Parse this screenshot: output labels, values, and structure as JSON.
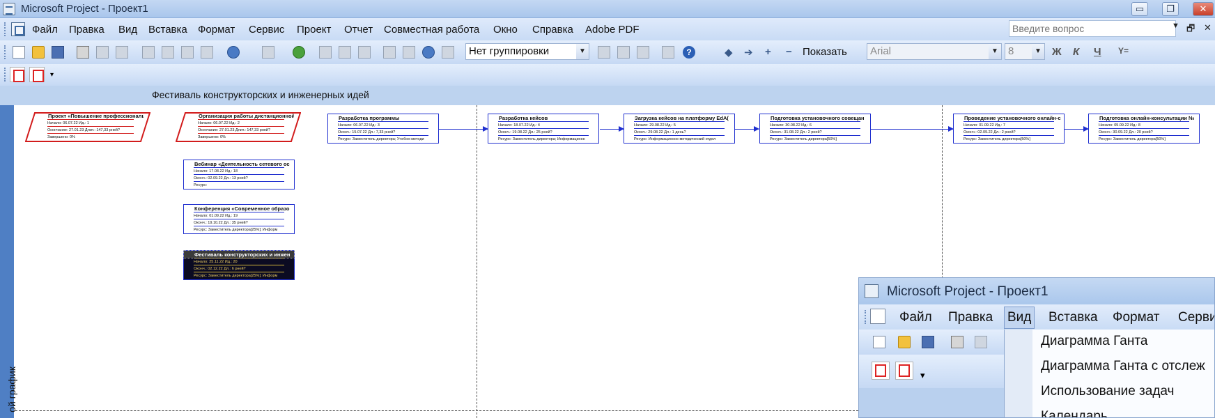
{
  "window": {
    "title": "Microsoft Project - Проект1",
    "buttons": {
      "minimize": "▭",
      "restore": "❐",
      "close": "✕"
    }
  },
  "menu": {
    "items": [
      "Файл",
      "Правка",
      "Вид",
      "Вставка",
      "Формат",
      "Сервис",
      "Проект",
      "Отчет",
      "Совместная работа",
      "Окно",
      "Справка",
      "Adobe PDF"
    ],
    "ask_placeholder": "Введите вопрос",
    "mdi_controls": [
      "▾",
      "🗗",
      "✕"
    ]
  },
  "toolbar": {
    "grouping": "Нет группировки",
    "show_label": "Показать",
    "font": "Arial",
    "font_size": "8",
    "format_buttons": [
      "Ж",
      "К",
      "Ч"
    ],
    "filter_symbol": "Y="
  },
  "project_title": "Фестиваль конструкторских и инженерных идей",
  "side_tab": "ой график",
  "nodes": [
    {
      "title": "Проект «Повышение профессионалы",
      "r1": "Начало:   06.07.22      Ид.:    1",
      "r2": "Окончание: 27.01.23   Длит.: 147,33 рней?",
      "r3": "Завершено: 0%",
      "kind": "crit"
    },
    {
      "title": "Организация работы дистанционной ст",
      "r1": "Начало:   06.07.22      Ид.:    2",
      "r2": "Окончание: 27.01.23   Длит.: 147,33 рней?",
      "r3": "Завершено: 0%",
      "kind": "crit"
    },
    {
      "title": "Разработка программы",
      "r1": "Начало:   06.07.22      Ид.:    3",
      "r2": "Оконч.: 15.07.22       Дл.: 7,33 рней?",
      "r3": "Ресурс:  Заместитель директора; Учебно-методи",
      "kind": "norm"
    },
    {
      "title": "Разработка кейсов",
      "r1": "Начало:   18.07.22      Ид.:    4",
      "r2": "Оконч.: 19.08.22       Дл.: 25 рней?",
      "r3": "Ресурс:  Заместитель директора; Информационн",
      "kind": "norm"
    },
    {
      "title": "Загрузка кейсов на платформу EdA(",
      "r1": "Начало:   29.08.22      Ид.:    5",
      "r2": "Оконч.: 29.08.22       Дл.: 1 день?",
      "r3": "Ресурс:  Информационно-методический отдел",
      "kind": "norm"
    },
    {
      "title": "Подготовка установочного совещан",
      "r1": "Начало:   30.08.22      Ид.:    6",
      "r2": "Оконч.: 31.08.22       Дл.: 2 рней?",
      "r3": "Ресурс:  Заместитель директора[50%]",
      "kind": "norm"
    },
    {
      "title": "Проведение установочного онлайн-с",
      "r1": "Начало:   01.09.22      Ид.:    7",
      "r2": "Оконч.: 02.09.22       Дл.: 2 рней?",
      "r3": "Ресурс:  Заместитель директора[50%]",
      "kind": "norm"
    },
    {
      "title": "Подготовка онлайн-консультации №",
      "r1": "Начало:   05.09.22      Ид.:    8",
      "r2": "Оконч.: 30.09.22       Дл.: 20 рней?",
      "r3": "Ресурс:  Заместитель директора[50%]",
      "kind": "norm"
    },
    {
      "title": "Вебинар «Деятельность сетевого ос",
      "r1": "Начало:   17.08.22      Ид.:    18",
      "r2": "Оконч.: 02.09.22       Дл.: 13 рней?",
      "r3": "Ресурс:",
      "kind": "norm"
    },
    {
      "title": "Конференция «Современное образо",
      "r1": "Начало:   01.09.22      Ид.:    19",
      "r2": "Оконч.: 19.10.22       Дл.: 35 рней?",
      "r3": "Ресурс:  Заместитель директора[25%]; Информ",
      "kind": "norm"
    },
    {
      "title": "Фестиваль конструкторских и инжен",
      "r1": "Начало:   25.11.22      Ид.:    20",
      "r2": "Оконч.: 02.12.22       Дл.: 6 рней?",
      "r3": "Ресурс:  Заместитель директора[25%]; Информ",
      "kind": "sel"
    }
  ],
  "popup": {
    "title": "Microsoft Project - Проект1",
    "menu": [
      "Файл",
      "Правка",
      "Вид",
      "Вставка",
      "Формат",
      "Серви"
    ],
    "dropdown_items": [
      "Диаграмма Ганта",
      "Диаграмма Ганта с отслеж",
      "Использование задач",
      "Календарь"
    ]
  }
}
